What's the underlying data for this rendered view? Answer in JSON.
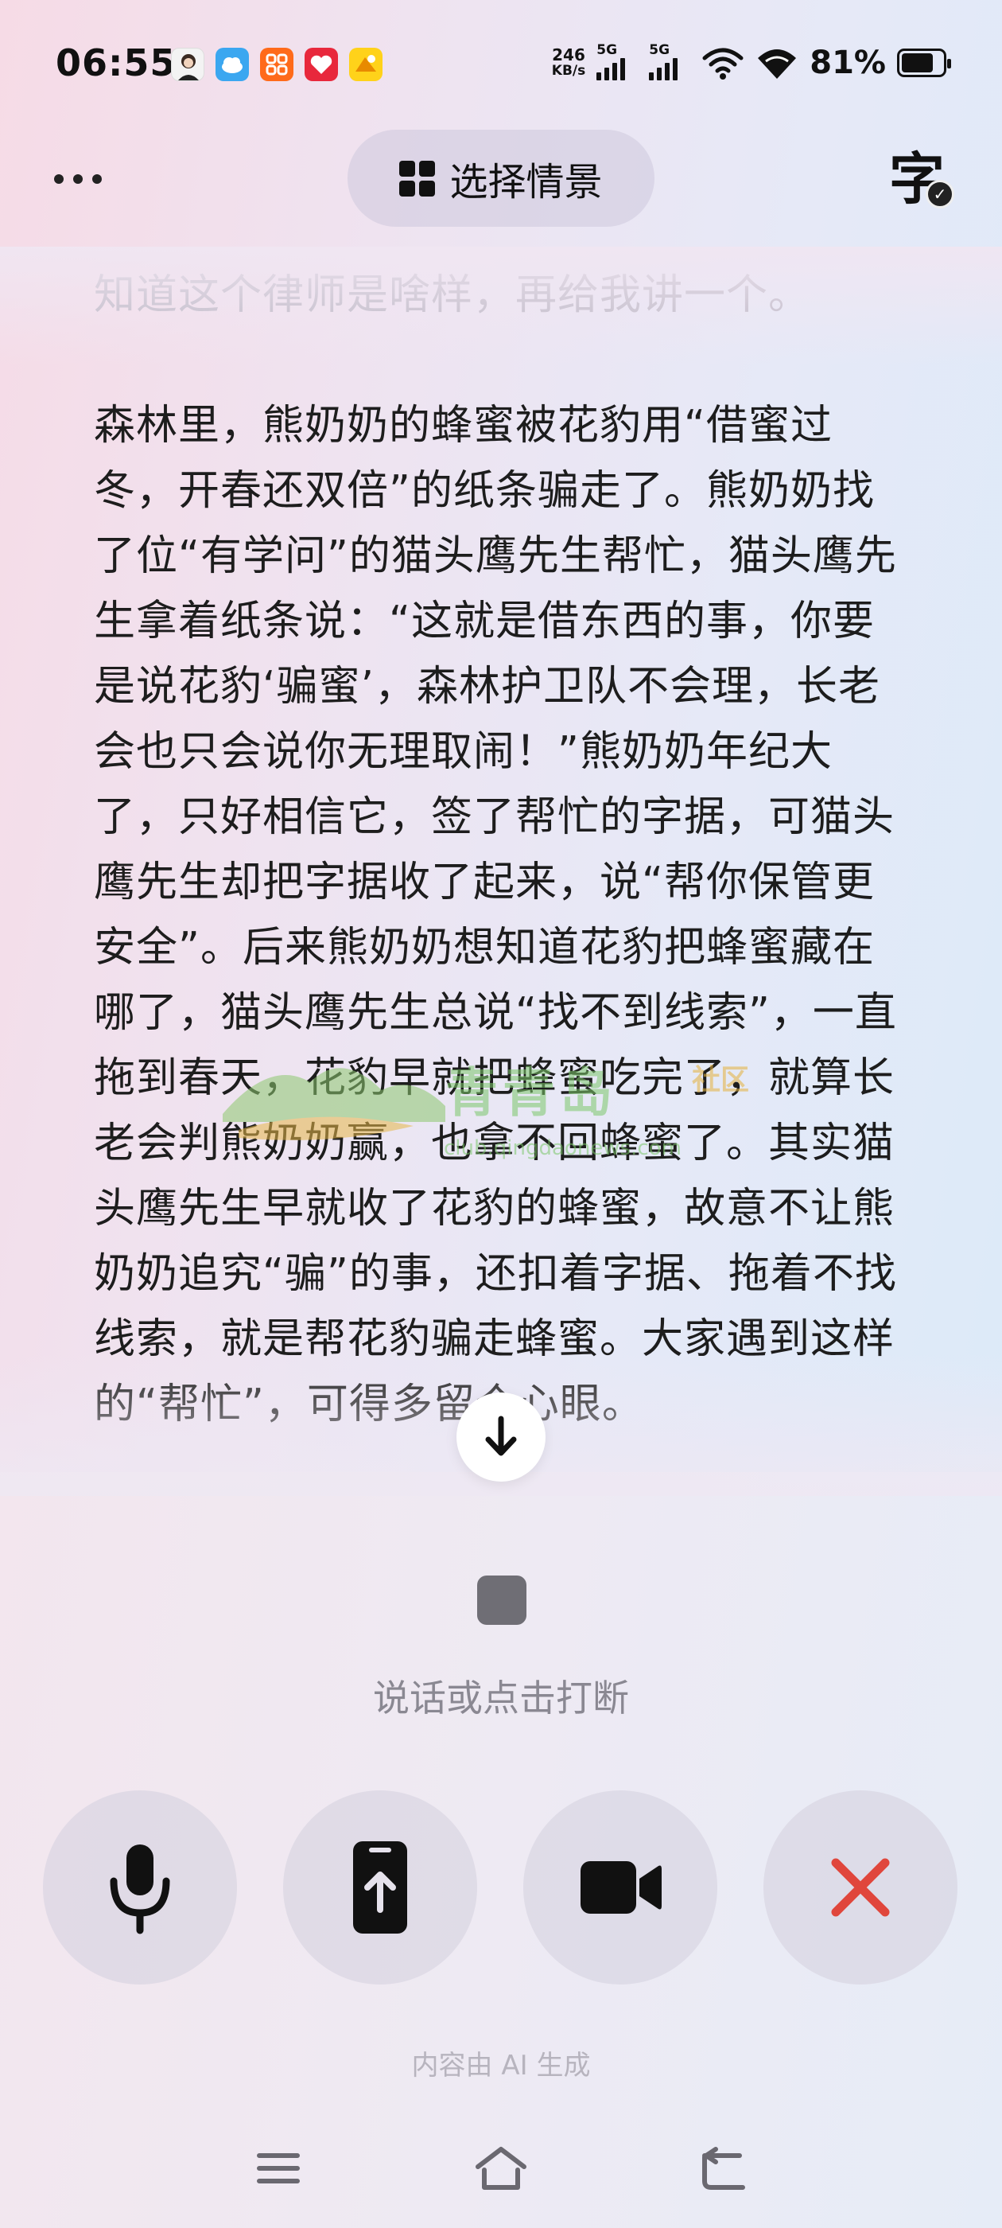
{
  "status_bar": {
    "time": "06:55",
    "net_speed_value": "246",
    "net_speed_unit": "KB/s",
    "sim1_label": "5G",
    "sim2_label": "5G",
    "battery_percent": "81%",
    "battery_level": 0.81,
    "notification_icons": [
      "avatar-app-icon",
      "cloud-app-icon",
      "orange-app-icon",
      "red-heart-app-icon",
      "yellow-app-icon"
    ]
  },
  "top_bar": {
    "scene_button_label": "选择情景",
    "subtitle_toggle_glyph": "字",
    "subtitle_toggle_check": "✓"
  },
  "transcript": {
    "previous_message": "派出所，别说律师。给我讲进程呀？大家都知道这个律师是啥样，再给我讲一个。",
    "current_message": "森林里，熊奶奶的蜂蜜被花豹用“借蜜过冬，开春还双倍”的纸条骗走了。熊奶奶找了位“有学问”的猫头鹰先生帮忙，猫头鹰先生拿着纸条说：“这就是借东西的事，你要是说花豹‘骗蜜’，森林护卫队不会理，长老会也只会说你无理取闹！”熊奶奶年纪大了，只好相信它，签了帮忙的字据，可猫头鹰先生却把字据收了起来，说“帮你保管更安全”。后来熊奶奶想知道花豹把蜂蜜藏在哪了，猫头鹰先生总说“找不到线索”，一直拖到春天，花豹早就把蜂蜜吃完了，就算长老会判熊奶奶赢，也拿不回蜂蜜了。其实猫头鹰先生早就收了花豹的蜂蜜，故意不让熊奶奶追究“骗”的事，还扣着字据、拖着不找线索，就是帮花豹骗走蜂蜜。大家遇到这样的“帮忙”，可得多留个心眼。"
  },
  "watermark": {
    "main": "青青岛",
    "tag": "社区",
    "url": "club.qingdaonews.com"
  },
  "voice": {
    "hint": "说话或点击打断"
  },
  "controls": [
    "microphone-icon",
    "share-screen-icon",
    "video-camera-icon",
    "close-icon"
  ],
  "footer": {
    "ai_note": "内容由 AI 生成"
  },
  "colors": {
    "close_red": "#e0463c",
    "stop_grey": "#6f6e75",
    "hint_grey": "#8a8892"
  }
}
